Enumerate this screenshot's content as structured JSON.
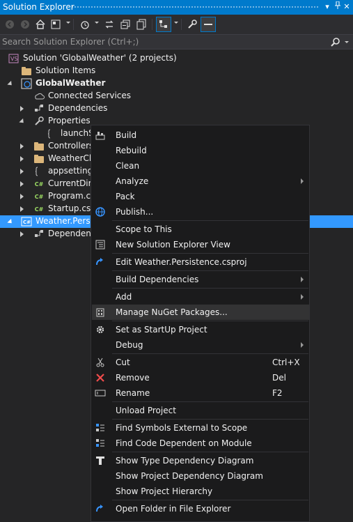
{
  "window": {
    "title": "Solution Explorer"
  },
  "search": {
    "placeholder": "Search Solution Explorer (Ctrl+;)"
  },
  "toolbar": {
    "icons": [
      "back-icon",
      "forward-icon",
      "home-icon",
      "switch-views-icon",
      "pending-changes-filter-icon",
      "sync-with-document-icon",
      "collapse-all-icon",
      "show-all-files-icon",
      "preview-selected-icon",
      "properties-icon",
      "preview-pane-icon"
    ]
  },
  "tree": {
    "items": [
      {
        "label": "Solution 'GlobalWeather' (2 projects)",
        "icon": "solution-icon"
      },
      {
        "label": "Solution Items",
        "icon": "folder-icon"
      },
      {
        "label": "GlobalWeather",
        "icon": "web-project-icon"
      },
      {
        "label": "Connected Services",
        "icon": "connected-services-icon"
      },
      {
        "label": "Dependencies",
        "icon": "dependencies-icon"
      },
      {
        "label": "Properties",
        "icon": "wrench-icon"
      },
      {
        "label": "launchS",
        "icon": "json-file-icon"
      },
      {
        "label": "Controllers",
        "icon": "folder-icon"
      },
      {
        "label": "WeatherCli",
        "icon": "folder-icon"
      },
      {
        "label": "appsettings",
        "icon": "json-file-icon"
      },
      {
        "label": "CurrentDire",
        "icon": "csharp-file-icon"
      },
      {
        "label": "Program.cs",
        "icon": "csharp-file-icon"
      },
      {
        "label": "Startup.cs",
        "icon": "csharp-file-icon"
      },
      {
        "label": "Weather.Persis",
        "icon": "csharp-project-icon"
      },
      {
        "label": "Dependenc",
        "icon": "dependencies-icon"
      }
    ]
  },
  "context_menu": {
    "items": [
      {
        "label": "Build",
        "icon": "build-icon"
      },
      {
        "label": "Rebuild"
      },
      {
        "label": "Clean"
      },
      {
        "label": "Analyze",
        "submenu": true
      },
      {
        "label": "Pack"
      },
      {
        "label": "Publish...",
        "icon": "globe-icon"
      },
      {
        "label": "Scope to This"
      },
      {
        "label": "New Solution Explorer View",
        "icon": "new-view-icon"
      },
      {
        "label": "Edit Weather.Persistence.csproj",
        "icon": "edit-arrow-icon"
      },
      {
        "label": "Build Dependencies",
        "submenu": true
      },
      {
        "label": "Add",
        "submenu": true
      },
      {
        "label": "Manage NuGet Packages...",
        "icon": "nuget-icon",
        "highlighted": true
      },
      {
        "label": "Set as StartUp Project",
        "icon": "gear-icon"
      },
      {
        "label": "Debug",
        "submenu": true
      },
      {
        "label": "Cut",
        "icon": "scissors-icon",
        "shortcut": "Ctrl+X"
      },
      {
        "label": "Remove",
        "icon": "close-icon",
        "shortcut": "Del"
      },
      {
        "label": "Rename",
        "icon": "rename-icon",
        "shortcut": "F2"
      },
      {
        "label": "Unload Project"
      },
      {
        "label": "Find Symbols External to Scope",
        "icon": "find-symbols-icon"
      },
      {
        "label": "Find Code Dependent on Module",
        "icon": "find-code-icon"
      },
      {
        "label": "Show Type Dependency Diagram",
        "icon": "type-diagram-icon"
      },
      {
        "label": "Show Project Dependency Diagram"
      },
      {
        "label": "Show Project Hierarchy"
      },
      {
        "label": "Open Folder in File Explorer",
        "icon": "open-folder-arrow-icon"
      }
    ]
  },
  "colors": {
    "accent": "#007acc",
    "selection": "#3399ff",
    "background": "#252526",
    "menu_background": "#1b1b1c",
    "folder": "#dcb67a",
    "csharp": "#9cdc63"
  }
}
